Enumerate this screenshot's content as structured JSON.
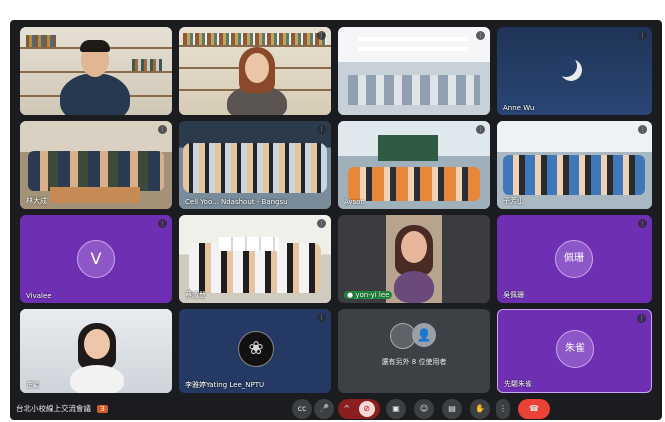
{
  "meeting": {
    "title": "台北小校線上交流會議",
    "participant_badge": "3"
  },
  "tiles": [
    {
      "name": "",
      "kind": "camera"
    },
    {
      "name": "",
      "kind": "camera"
    },
    {
      "name": "",
      "kind": "camera"
    },
    {
      "name": "Anne Wu",
      "kind": "camera-dark"
    },
    {
      "name": "林大成",
      "kind": "camera"
    },
    {
      "name": "Cell Yoo... Ndashout - Bangsu",
      "kind": "camera"
    },
    {
      "name": "Ayson",
      "kind": "camera"
    },
    {
      "name": "子芳山",
      "kind": "camera"
    },
    {
      "name": "Vivalee",
      "kind": "avatar",
      "avatar_text": "V"
    },
    {
      "name": "蔡淑慧",
      "kind": "camera"
    },
    {
      "name": "yon-yi lee",
      "kind": "camera"
    },
    {
      "name": "吳佩珊",
      "kind": "avatar",
      "avatar_text": "佩珊"
    },
    {
      "name": "芷穎",
      "kind": "camera"
    },
    {
      "name": "李雅婷Yating Lee_NPTU",
      "kind": "avatar-photo"
    },
    {
      "name": "",
      "kind": "others",
      "others_text": "還有另外 8 位使用者"
    },
    {
      "name": "先驅朱雀",
      "kind": "avatar",
      "avatar_text": "朱雀"
    }
  ],
  "controls": {
    "captions": "cc",
    "mic": "mic-icon",
    "camera_off": "camera-off-icon",
    "present": "present-icon",
    "emoji": "emoji-icon",
    "raise_hand": "hand-icon",
    "more": "more-icon",
    "leave": "leave-call-icon",
    "chevron": "^"
  },
  "colors": {
    "avatar_purple": "#6f2fb3",
    "leave_red": "#ea4335",
    "background": "#1b1c1f"
  }
}
